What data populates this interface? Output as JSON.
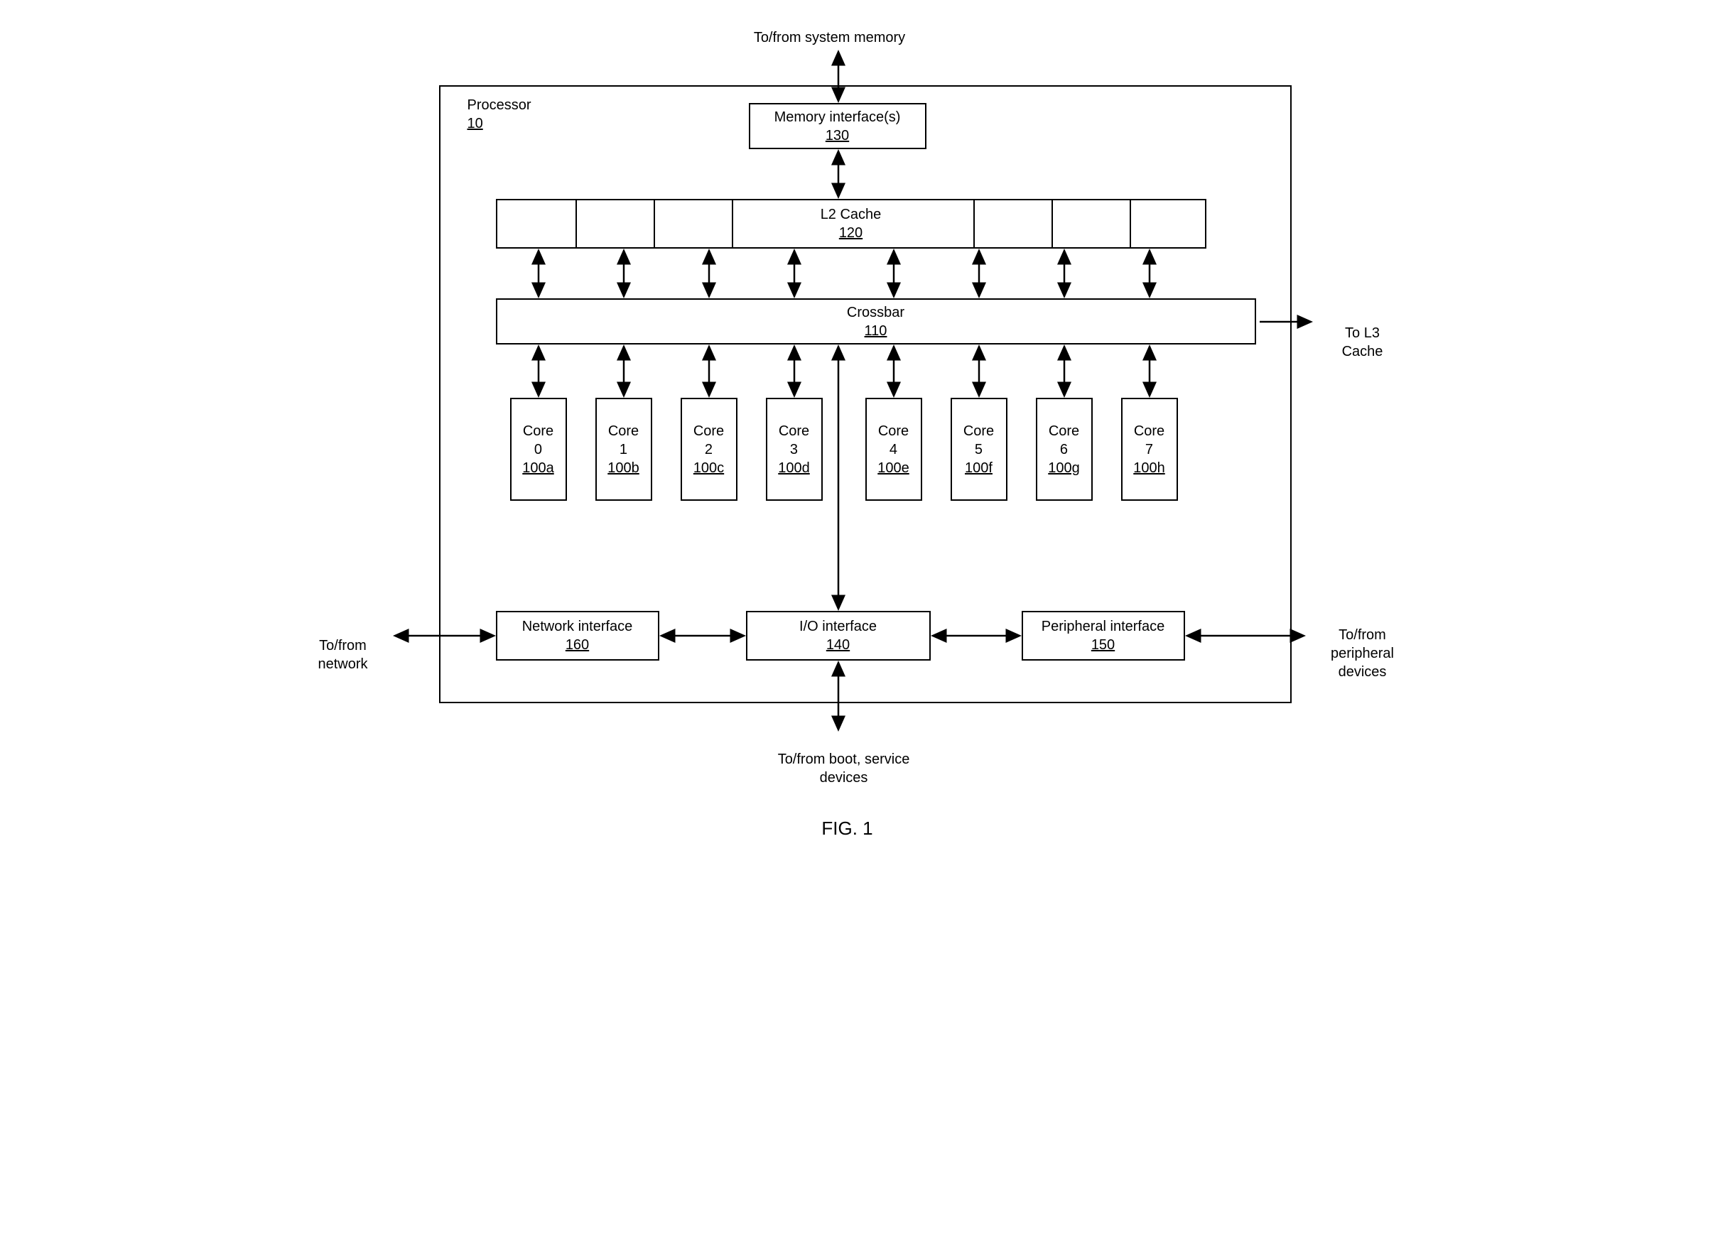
{
  "external": {
    "top": "To/from system memory",
    "right": "To L3\nCache",
    "left": "To/from\nnetwork",
    "bottomRight": "To/from\nperipheral\ndevices",
    "bottom": "To/from boot, service\ndevices"
  },
  "processor": {
    "title": "Processor",
    "ref": "10"
  },
  "memInterface": {
    "title": "Memory interface(s)",
    "ref": "130"
  },
  "l2cache": {
    "title": "L2 Cache",
    "ref": "120"
  },
  "crossbar": {
    "title": "Crossbar",
    "ref": "110"
  },
  "cores": [
    {
      "title": "Core\n0",
      "ref": "100a"
    },
    {
      "title": "Core\n1",
      "ref": "100b"
    },
    {
      "title": "Core\n2",
      "ref": "100c"
    },
    {
      "title": "Core\n3",
      "ref": "100d"
    },
    {
      "title": "Core\n4",
      "ref": "100e"
    },
    {
      "title": "Core\n5",
      "ref": "100f"
    },
    {
      "title": "Core\n6",
      "ref": "100g"
    },
    {
      "title": "Core\n7",
      "ref": "100h"
    }
  ],
  "netInterface": {
    "title": "Network interface",
    "ref": "160"
  },
  "ioInterface": {
    "title": "I/O interface",
    "ref": "140"
  },
  "periphInterface": {
    "title": "Peripheral interface",
    "ref": "150"
  },
  "figure": "FIG. 1"
}
